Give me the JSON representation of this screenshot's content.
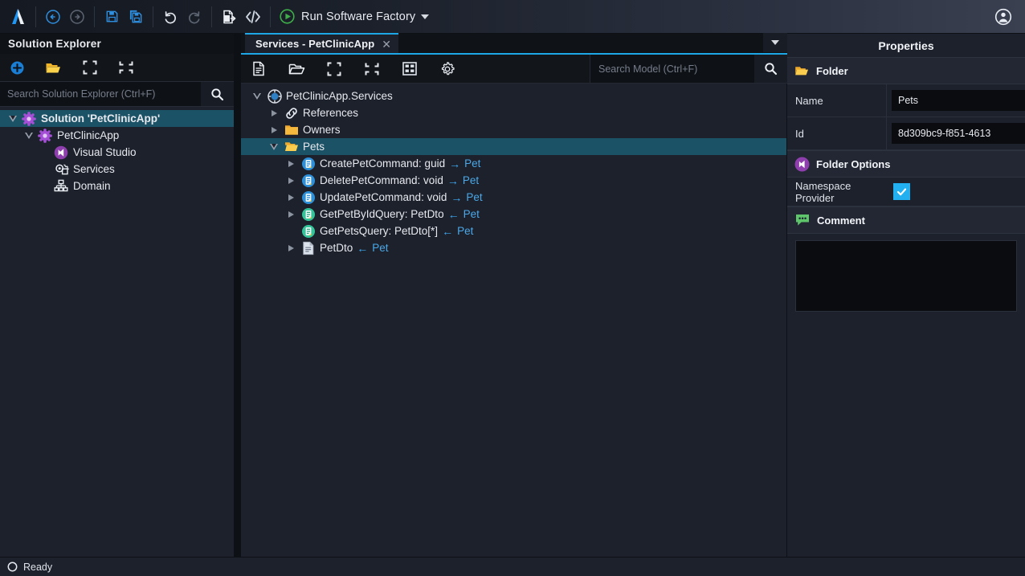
{
  "topbar": {
    "logo_icon": "intent-architect-logo",
    "nav": [
      {
        "name": "back-button",
        "icon": "arrow-left-circle-icon"
      },
      {
        "name": "forward-button",
        "icon": "arrow-right-circle-icon"
      },
      {
        "name": "save-button",
        "icon": "save-icon"
      },
      {
        "name": "save-all-button",
        "icon": "save-all-icon"
      },
      {
        "name": "undo-button",
        "icon": "undo-icon"
      },
      {
        "name": "redo-button",
        "icon": "redo-icon"
      },
      {
        "name": "export-button",
        "icon": "file-export-icon"
      },
      {
        "name": "code-button",
        "icon": "code-brackets-icon"
      }
    ],
    "run_label": "Run Software Factory",
    "run_icon": "play-circle-icon",
    "user_icon": "user-account-icon"
  },
  "sidebar": {
    "title": "Solution Explorer",
    "toolbar": [
      {
        "name": "add-button",
        "icon": "plus-circle-icon"
      },
      {
        "name": "open-folder-button",
        "icon": "folder-open-icon"
      },
      {
        "name": "expand-all-button",
        "icon": "expand-icon"
      },
      {
        "name": "collapse-all-button",
        "icon": "collapse-icon"
      }
    ],
    "search": {
      "placeholder": "Search Solution Explorer (Ctrl+F)",
      "value": "",
      "icon": "search-icon"
    },
    "tree": [
      {
        "label": "Solution 'PetClinicApp'",
        "icon": "solution-icon",
        "indent": 0,
        "expander": "down",
        "selected": true,
        "bold": true
      },
      {
        "label": "PetClinicApp",
        "icon": "application-icon",
        "indent": 1,
        "expander": "down",
        "selected": false,
        "bold": false
      },
      {
        "label": "Visual Studio",
        "icon": "visual-studio-icon",
        "indent": 2,
        "expander": "none",
        "selected": false,
        "bold": false
      },
      {
        "label": "Services",
        "icon": "services-icon",
        "indent": 2,
        "expander": "none",
        "selected": false,
        "bold": false
      },
      {
        "label": "Domain",
        "icon": "domain-icon",
        "indent": 2,
        "expander": "none",
        "selected": false,
        "bold": false
      }
    ]
  },
  "main": {
    "tab": {
      "label": "Services - PetClinicApp",
      "close_icon": "close-icon"
    },
    "tabstrip_menu_icon": "chevron-down-icon",
    "toolbar": [
      {
        "name": "new-element-button",
        "icon": "file-new-icon"
      },
      {
        "name": "open-button",
        "icon": "folder-open-outline-icon"
      },
      {
        "name": "expand-all-button",
        "icon": "expand-icon"
      },
      {
        "name": "collapse-all-button",
        "icon": "collapse-icon"
      },
      {
        "name": "designer-button",
        "icon": "diagram-designer-icon"
      },
      {
        "name": "settings-button",
        "icon": "gear-icon"
      }
    ],
    "search": {
      "placeholder": "Search Model (Ctrl+F)",
      "value": "",
      "icon": "search-icon"
    },
    "tree": [
      {
        "label": "PetClinicApp.Services",
        "icon": "package-icon",
        "indent": 0,
        "expander": "down",
        "selected": false
      },
      {
        "label": "References",
        "icon": "link-icon",
        "indent": 1,
        "expander": "right",
        "selected": false
      },
      {
        "label": "Owners",
        "icon": "folder-closed-icon",
        "indent": 1,
        "expander": "right",
        "selected": false
      },
      {
        "label": "Pets",
        "icon": "folder-open-yellow-icon",
        "indent": 1,
        "expander": "down",
        "selected": true
      },
      {
        "label": "CreatePetCommand: guid",
        "icon": "command-icon",
        "indent": 2,
        "expander": "right",
        "selected": false,
        "rel_arrow": "→",
        "rel_target": "Pet"
      },
      {
        "label": "DeletePetCommand: void",
        "icon": "command-icon",
        "indent": 2,
        "expander": "right",
        "selected": false,
        "rel_arrow": "→",
        "rel_target": "Pet"
      },
      {
        "label": "UpdatePetCommand: void",
        "icon": "command-icon",
        "indent": 2,
        "expander": "right",
        "selected": false,
        "rel_arrow": "→",
        "rel_target": "Pet"
      },
      {
        "label": "GetPetByIdQuery: PetDto",
        "icon": "query-icon",
        "indent": 2,
        "expander": "right",
        "selected": false,
        "rel_arrow": "←",
        "rel_target": "Pet"
      },
      {
        "label": "GetPetsQuery: PetDto[*]",
        "icon": "query-icon",
        "indent": 2,
        "expander": "none",
        "selected": false,
        "rel_arrow": "←",
        "rel_target": "Pet"
      },
      {
        "label": "PetDto",
        "icon": "dto-icon",
        "indent": 2,
        "expander": "right",
        "selected": false,
        "rel_arrow": "←",
        "rel_target": "Pet"
      }
    ]
  },
  "properties": {
    "title": "Properties",
    "sections": [
      {
        "label": "Folder",
        "icon": "folder-open-yellow-icon"
      },
      {
        "label": "Folder Options",
        "icon": "visual-studio-icon"
      },
      {
        "label": "Comment",
        "icon": "comment-bubble-icon"
      }
    ],
    "name_label": "Name",
    "name_value": "Pets",
    "id_label": "Id",
    "id_value": "8d309bc9-f851-4613",
    "copy_icon": "clipboard-icon",
    "namespace_provider_label": "Namespace Provider",
    "namespace_provider_checked": true,
    "check_icon": "check-icon",
    "comment_value": "",
    "comment_placeholder": ""
  },
  "statusbar": {
    "icon": "circle-outline-icon",
    "text": "Ready"
  },
  "colors": {
    "accent_cyan": "#1ea7e6",
    "selection": "#1b5265",
    "folder_yellow": "#f0a830",
    "command_blue": "#2d8fd8",
    "query_green": "#35c49a",
    "link_blue": "#4aa8e8",
    "checkbox_blue": "#22b0f0",
    "run_green": "#3fae4a",
    "panel_bg": "#1d212b"
  }
}
